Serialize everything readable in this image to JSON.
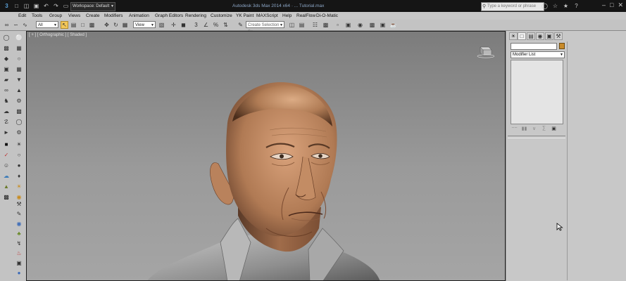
{
  "titlebar": {
    "workspace": "Workspace: Default",
    "app_title": "Autodesk 3ds Max 2014 x64 · ... Tutorial.max",
    "search_placeholder": "Type a keyword or phrase"
  },
  "menu": {
    "items": [
      "Edit",
      "Tools",
      "Group",
      "Views",
      "Create",
      "Modifiers",
      "Animation",
      "Graph Editors",
      "Rendering",
      "Customize",
      "YK Paint",
      "MAXScript",
      "Help",
      "RealFlow",
      "Di-O-Matic"
    ]
  },
  "toolbar": {
    "selection_filter": "All",
    "coordinate_system": "View",
    "named_selection": "Create Selection Se"
  },
  "viewport": {
    "label": "[ + ] [ Orthographic ] [ Shaded ]"
  },
  "command_panel": {
    "name_value": "",
    "modifier_list": "Modifier List"
  },
  "colors": {
    "highlight": "#f2c75a",
    "object_color": "#c98b2a",
    "viewport_bg": "#8c8c8c"
  }
}
